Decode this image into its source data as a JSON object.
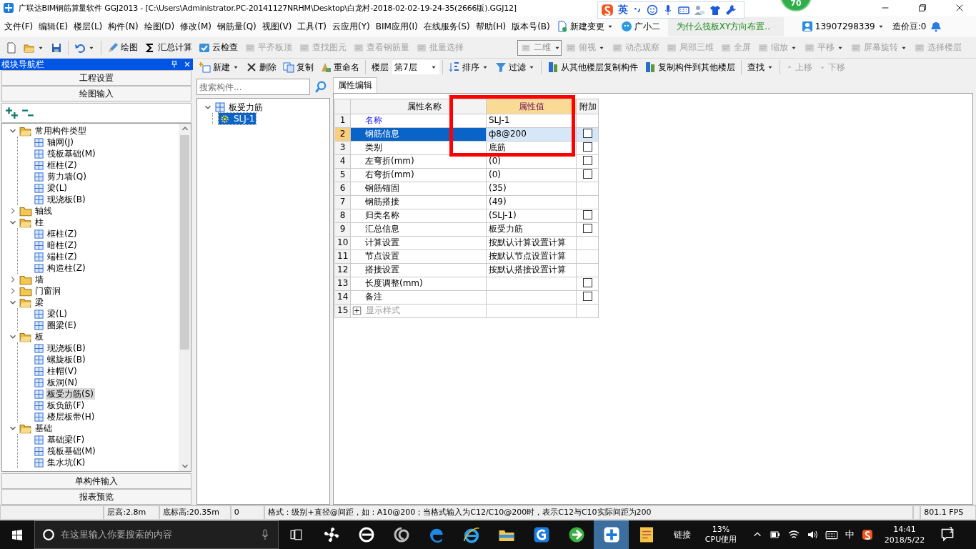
{
  "window": {
    "title": "广联达BIM钢筋算量软件 GGJ2013 - [C:\\Users\\Administrator.PC-20141127NRHM\\Desktop\\白龙村-2018-02-02-19-24-35(2666版).GGJ12]"
  },
  "ime_bar": {
    "mode": "英"
  },
  "badge": {
    "text": "70"
  },
  "menu": {
    "items": [
      "文件(F)",
      "编辑(E)",
      "楼层(L)",
      "构件(N)",
      "绘图(D)",
      "修改(M)",
      "钢筋量(Q)",
      "视图(V)",
      "工具(T)",
      "云应用(Y)",
      "BIM应用(I)",
      "在线服务(S)",
      "帮助(H)",
      "版本号(B)"
    ],
    "change": "新建变更",
    "assistant": "广小二",
    "news": "为什么筏板XY方向布置..",
    "account": "13907298339",
    "beans": "造价豆:0"
  },
  "toolbar": {
    "items": [
      {
        "label": "绘图",
        "disabled": false
      },
      {
        "label": "汇总计算",
        "disabled": false
      },
      {
        "label": "云检查",
        "disabled": false
      },
      {
        "label": "平齐板顶",
        "disabled": true
      },
      {
        "label": "查找图元",
        "disabled": true
      },
      {
        "label": "查看钢筋量",
        "disabled": true
      },
      {
        "label": "批量选择",
        "disabled": true
      }
    ],
    "view_mode": "二维",
    "view_items": [
      {
        "label": "俯视",
        "disabled": true,
        "dropdown": true
      },
      {
        "label": "动态观察",
        "disabled": true,
        "dropdown": false
      },
      {
        "label": "局部三维",
        "disabled": true,
        "dropdown": false
      },
      {
        "label": "全屏",
        "disabled": true,
        "dropdown": false
      },
      {
        "label": "缩放",
        "disabled": true,
        "dropdown": true
      },
      {
        "label": "平移",
        "disabled": true,
        "dropdown": true
      },
      {
        "label": "屏幕旋转",
        "disabled": true,
        "dropdown": true
      },
      {
        "label": "选择楼层",
        "disabled": true,
        "dropdown": false
      }
    ]
  },
  "nav": {
    "title": "模块导航栏",
    "top_sections": [
      "工程设置",
      "绘图输入"
    ],
    "tree": [
      {
        "label": "常用构件类型",
        "expanded": true,
        "selected": false,
        "children": [
          {
            "label": "轴网(J)",
            "selected": false
          },
          {
            "label": "筏板基础(M)",
            "selected": false
          },
          {
            "label": "框柱(Z)",
            "selected": false
          },
          {
            "label": "剪力墙(Q)",
            "selected": false
          },
          {
            "label": "梁(L)",
            "selected": false
          },
          {
            "label": "现浇板(B)",
            "selected": false
          }
        ]
      },
      {
        "label": "轴线",
        "expanded": false,
        "selected": false
      },
      {
        "label": "柱",
        "expanded": true,
        "selected": false,
        "children": [
          {
            "label": "框柱(Z)",
            "selected": false
          },
          {
            "label": "暗柱(Z)",
            "selected": false
          },
          {
            "label": "端柱(Z)",
            "selected": false
          },
          {
            "label": "构造柱(Z)",
            "selected": false
          }
        ]
      },
      {
        "label": "墙",
        "expanded": false,
        "selected": false
      },
      {
        "label": "门窗洞",
        "expanded": false,
        "selected": false
      },
      {
        "label": "梁",
        "expanded": true,
        "selected": false,
        "children": [
          {
            "label": "梁(L)",
            "selected": false
          },
          {
            "label": "圈梁(E)",
            "selected": false
          }
        ]
      },
      {
        "label": "板",
        "expanded": true,
        "selected": false,
        "children": [
          {
            "label": "现浇板(B)",
            "selected": false
          },
          {
            "label": "螺旋板(B)",
            "selected": false
          },
          {
            "label": "柱帽(V)",
            "selected": false
          },
          {
            "label": "板洞(N)",
            "selected": false
          },
          {
            "label": "板受力筋(S)",
            "selected": true
          },
          {
            "label": "板负筋(F)",
            "selected": false
          },
          {
            "label": "楼层板带(H)",
            "selected": false
          }
        ]
      },
      {
        "label": "基础",
        "expanded": true,
        "selected": false,
        "children": [
          {
            "label": "基础梁(F)",
            "selected": false
          },
          {
            "label": "筏板基础(M)",
            "selected": false
          },
          {
            "label": "集水坑(K)",
            "selected": false
          }
        ]
      }
    ],
    "bottom_sections": [
      "单构件输入",
      "报表预览"
    ]
  },
  "component_toolbar": {
    "items": [
      {
        "label": "新建",
        "dropdown": true,
        "disabled": false
      },
      {
        "label": "删除",
        "dropdown": false,
        "disabled": false
      },
      {
        "label": "复制",
        "dropdown": false,
        "disabled": false
      },
      {
        "label": "重命名",
        "dropdown": false,
        "disabled": false
      }
    ],
    "floor_label": "楼层",
    "floor": "第7层",
    "items2": [
      {
        "label": "排序",
        "dropdown": true,
        "disabled": false
      },
      {
        "label": "过滤",
        "dropdown": true,
        "disabled": false
      },
      {
        "label": "从其他楼层复制构件",
        "dropdown": false,
        "disabled": false
      },
      {
        "label": "复制构件到其他楼层",
        "dropdown": false,
        "disabled": false
      },
      {
        "label": "查找",
        "dropdown": true,
        "disabled": false
      },
      {
        "label": "上移",
        "dropdown": false,
        "disabled": true
      },
      {
        "label": "下移",
        "dropdown": false,
        "disabled": true
      }
    ]
  },
  "components": {
    "search_placeholder": "搜索构件...",
    "tree": [
      {
        "label": "板受力筋",
        "expanded": true,
        "selected": false,
        "children": [
          {
            "label": "SLJ-1",
            "selected": true
          }
        ]
      }
    ]
  },
  "properties": {
    "tab": "属性编辑",
    "columns": [
      "属性名称",
      "属性值",
      "附加"
    ],
    "rows": [
      {
        "num": "1",
        "name": "名称",
        "value": "SLJ-1",
        "kind": "key",
        "selected": false
      },
      {
        "num": "2",
        "name": "钢筋信息",
        "value": "ф8@200",
        "kind": "normal",
        "selected": true,
        "checked": false
      },
      {
        "num": "3",
        "name": "类别",
        "value": "底筋",
        "kind": "normal",
        "selected": false,
        "checked": false
      },
      {
        "num": "4",
        "name": "左弯折(mm)",
        "value": "(0)",
        "kind": "normal",
        "selected": false,
        "checked": false
      },
      {
        "num": "5",
        "name": "右弯折(mm)",
        "value": "(0)",
        "kind": "normal",
        "selected": false,
        "checked": false
      },
      {
        "num": "6",
        "name": "钢筋锚固",
        "value": "(35)",
        "kind": "normal",
        "selected": false
      },
      {
        "num": "7",
        "name": "钢筋搭接",
        "value": "(49)",
        "kind": "normal",
        "selected": false
      },
      {
        "num": "8",
        "name": "归类名称",
        "value": "(SLJ-1)",
        "kind": "normal",
        "selected": false,
        "checked": false
      },
      {
        "num": "9",
        "name": "汇总信息",
        "value": "板受力筋",
        "kind": "normal",
        "selected": false,
        "checked": false
      },
      {
        "num": "10",
        "name": "计算设置",
        "value": "按默认计算设置计算",
        "kind": "normal",
        "selected": false
      },
      {
        "num": "11",
        "name": "节点设置",
        "value": "按默认节点设置计算",
        "kind": "normal",
        "selected": false
      },
      {
        "num": "12",
        "name": "搭接设置",
        "value": "按默认搭接设置计算",
        "kind": "normal",
        "selected": false
      },
      {
        "num": "13",
        "name": "长度调整(mm)",
        "kind": "normal",
        "selected": false,
        "checked": false
      },
      {
        "num": "14",
        "name": "备注",
        "kind": "normal",
        "selected": false,
        "checked": false
      },
      {
        "num": "15",
        "name": "显示样式",
        "kind": "group",
        "expanded": false,
        "selected": false
      }
    ]
  },
  "status_bar": {
    "cells": [
      "层高:2.8m",
      "底标高:20.35m",
      "0",
      "格式：级别+直径@间距，如：A10@200；当格式输入为C12/C10@200时，表示C12与C10实际间距为200",
      "801.1 FPS"
    ]
  },
  "taskbar": {
    "search_placeholder": "在这里输入你要搜索的内容",
    "apps": [
      {
        "selected": false
      },
      {
        "selected": false
      },
      {
        "selected": false
      },
      {
        "selected": false
      },
      {
        "selected": false
      },
      {
        "selected": false
      },
      {
        "selected": false
      },
      {
        "selected": false
      },
      {
        "selected": true
      },
      {
        "selected": false
      }
    ],
    "link": "链接",
    "cpu": "13%",
    "cpu_label": "CPU使用",
    "ime": "中",
    "time": "14:41",
    "date": "2018/5/22",
    "notifications": "1"
  }
}
